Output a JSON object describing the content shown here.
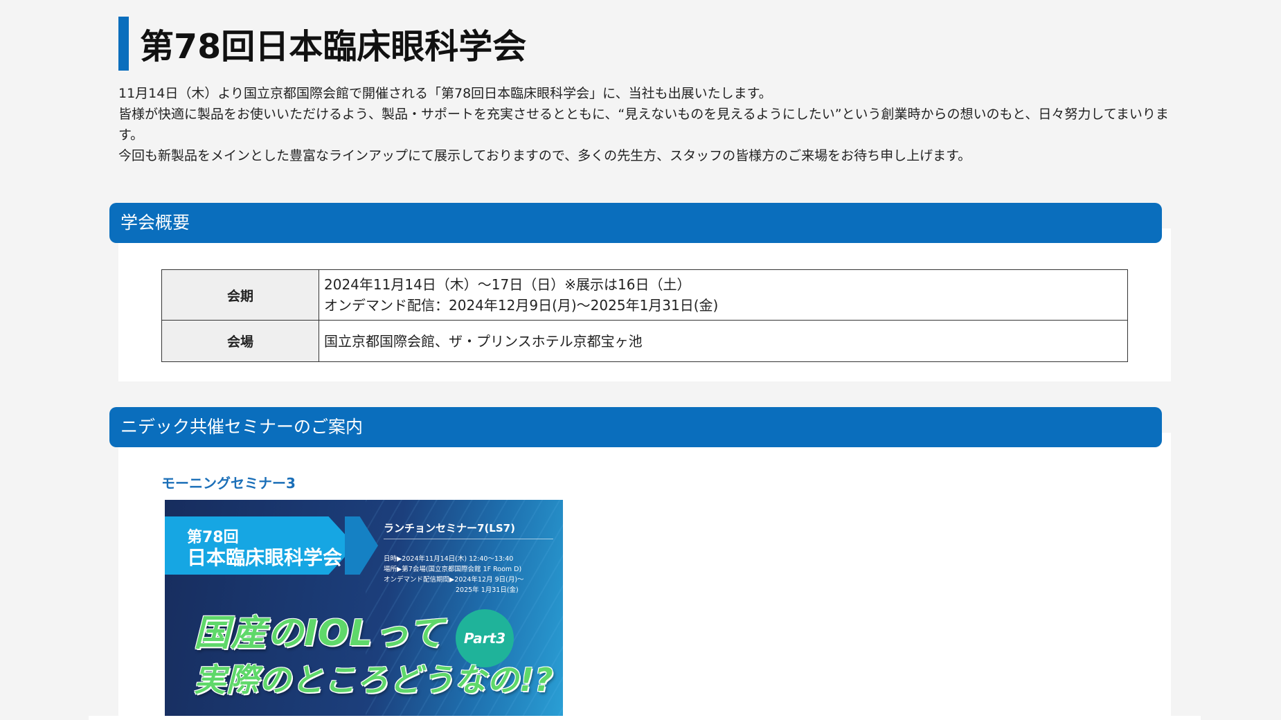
{
  "page": {
    "title": "第78回日本臨床眼科学会",
    "intro": [
      "11月14日（木）より国立京都国際会館で開催される「第78回日本臨床眼科学会」に、当社も出展いたします。",
      "皆様が快適に製品をお使いいただけるよう、製品・サポートを充実させるとともに、“見えないものを見えるようにしたい”という創業時からの想いのもと、日々努力してまいります。",
      "今回も新製品をメインとした豊富なラインアップにて展示しておりますので、多くの先生方、スタッフの皆様方のご来場をお待ち申し上げます。"
    ]
  },
  "overview": {
    "heading": "学会概要",
    "rows": [
      {
        "label": "会期",
        "lines": [
          "2024年11月14日（木）～17日（日）※展示は16日（土）",
          "オンデマンド配信：2024年12月9日(月)～2025年1月31日(金)"
        ]
      },
      {
        "label": "会場",
        "lines": [
          "国立京都国際会館、ザ・プリンスホテル京都宝ヶ池"
        ]
      }
    ]
  },
  "seminar": {
    "heading": "ニデック共催セミナーのご案内",
    "subtitle": "モーニングセミナー3",
    "banner": {
      "edition": "第78回",
      "society": "日本臨床眼科学会",
      "session": "ランチョンセミナー7(LS7)",
      "details": [
        "日時▶2024年11月14日(木) 12:40～13:40",
        "場所▶第7会場(国立京都国際会館 1F Room D)",
        "オンデマンド配信期間▶2024年12月 9日(月)～",
        "2025年 1月31日(金)"
      ],
      "headline_1": "国産のIOLって",
      "headline_2": "実際のところどうなの!?",
      "part": "Part3"
    }
  },
  "colors": {
    "accent": "#0a6ebd",
    "subtitle": "#1b6fb8",
    "background": "#f4f4f4",
    "panel": "#ffffff"
  }
}
